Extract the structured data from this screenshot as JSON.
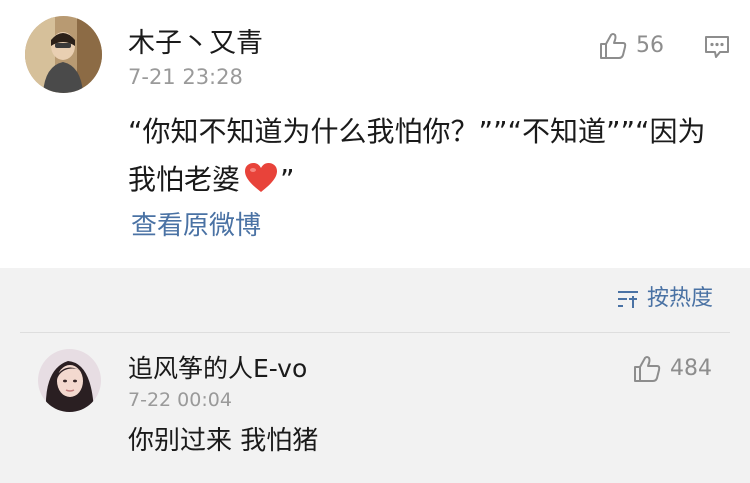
{
  "main_comment": {
    "username": "木子丶又青",
    "timestamp": "7-21 23:28",
    "likes": "56",
    "text_line1": "“你知不知道为什么我怕你？””“不知道””“因为",
    "text_line2_before_heart": "我怕老婆",
    "text_line2_after_heart": "”",
    "view_original": "查看原微博"
  },
  "sort": {
    "label": "按热度"
  },
  "reply": {
    "username": "追风筝的人E-vo",
    "timestamp": "7-22 00:04",
    "likes": "484",
    "text": "你别过来 我怕猪"
  },
  "icons": {
    "like": "thumbs-up-icon",
    "comment": "comment-icon",
    "sort": "sort-icon",
    "heart": "heart-emoji-icon"
  },
  "colors": {
    "link": "#4a72a4",
    "heart": "#e8433a",
    "muted": "#9a9a9a",
    "bar": "#f2f2f2"
  }
}
